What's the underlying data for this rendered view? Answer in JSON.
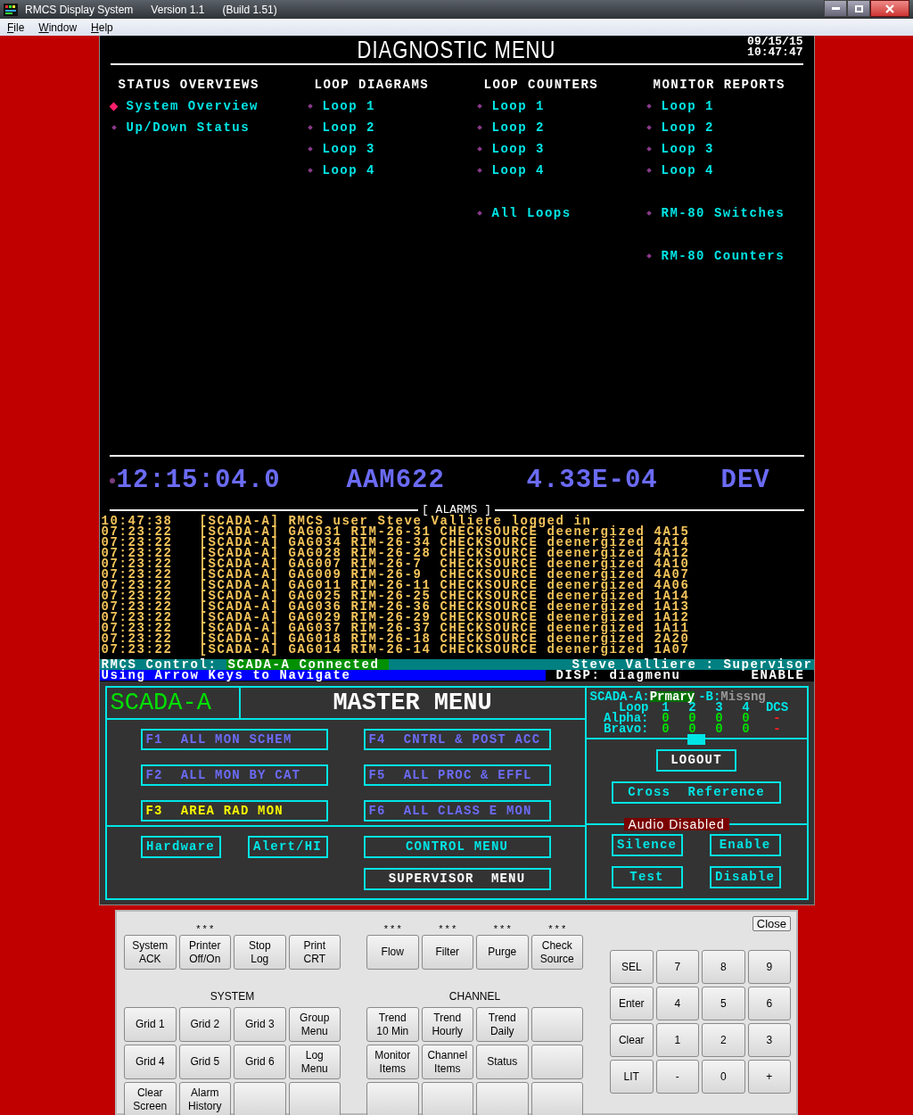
{
  "window": {
    "title": "RMCS Display System",
    "version": "Version 1.1",
    "build": "(Build 1.51)"
  },
  "menubar": [
    {
      "label": "File"
    },
    {
      "label": "Window"
    },
    {
      "label": "Help"
    }
  ],
  "screen": {
    "title": "DIAGNOSTIC MENU",
    "date": "09/15/15",
    "time": "10:47:47",
    "columns": [
      {
        "heading": "STATUS OVERVIEWS",
        "groups": [
          [
            {
              "label": "System Overview",
              "selected": true
            },
            {
              "label": "Up/Down Status",
              "selected": false
            }
          ]
        ]
      },
      {
        "heading": "LOOP DIAGRAMS",
        "groups": [
          [
            {
              "label": "Loop 1",
              "selected": false
            },
            {
              "label": "Loop 2",
              "selected": false
            },
            {
              "label": "Loop 3",
              "selected": false
            },
            {
              "label": "Loop 4",
              "selected": false
            }
          ]
        ]
      },
      {
        "heading": "LOOP COUNTERS",
        "groups": [
          [
            {
              "label": "Loop 1",
              "selected": false
            },
            {
              "label": "Loop 2",
              "selected": false
            },
            {
              "label": "Loop 3",
              "selected": false
            },
            {
              "label": "Loop 4",
              "selected": false
            }
          ],
          [
            {
              "label": "All Loops",
              "selected": false
            }
          ]
        ]
      },
      {
        "heading": "MONITOR REPORTS",
        "groups": [
          [
            {
              "label": "Loop 1",
              "selected": false
            },
            {
              "label": "Loop 2",
              "selected": false
            },
            {
              "label": "Loop 3",
              "selected": false
            },
            {
              "label": "Loop 4",
              "selected": false
            }
          ],
          [
            {
              "label": "RM-80 Switches",
              "selected": false
            }
          ],
          [
            {
              "label": "RM-80 Counters",
              "selected": false
            }
          ]
        ]
      }
    ],
    "readout": [
      "12:15:04.0",
      "AAM622",
      "4.33E-04",
      "DEV"
    ],
    "alarms_title": "[ ALARMS ]",
    "alarms": [
      {
        "time": "10:47:38",
        "source": "[SCADA-A]",
        "message": "RMCS user Steve Valliere logged in"
      },
      {
        "time": "07:23:22",
        "source": "[SCADA-A]",
        "message": "GAG031 RIM-26-31 CHECKSOURCE deenergized 4A15"
      },
      {
        "time": "07:23:22",
        "source": "[SCADA-A]",
        "message": "GAG034 RIM-26-34 CHECKSOURCE deenergized 4A14"
      },
      {
        "time": "07:23:22",
        "source": "[SCADA-A]",
        "message": "GAG028 RIM-26-28 CHECKSOURCE deenergized 4A12"
      },
      {
        "time": "07:23:22",
        "source": "[SCADA-A]",
        "message": "GAG007 RIM-26-7  CHECKSOURCE deenergized 4A10"
      },
      {
        "time": "07:23:22",
        "source": "[SCADA-A]",
        "message": "GAG009 RIM-26-9  CHECKSOURCE deenergized 4A07"
      },
      {
        "time": "07:23:22",
        "source": "[SCADA-A]",
        "message": "GAG011 RIM-26-11 CHECKSOURCE deenergized 4A06"
      },
      {
        "time": "07:23:22",
        "source": "[SCADA-A]",
        "message": "GAG025 RIM-26-25 CHECKSOURCE deenergized 1A14"
      },
      {
        "time": "07:23:22",
        "source": "[SCADA-A]",
        "message": "GAG036 RIM-26-36 CHECKSOURCE deenergized 1A13"
      },
      {
        "time": "07:23:22",
        "source": "[SCADA-A]",
        "message": "GAG029 RIM-26-29 CHECKSOURCE deenergized 1A12"
      },
      {
        "time": "07:23:22",
        "source": "[SCADA-A]",
        "message": "GAG037 RIM-26-37 CHECKSOURCE deenergized 1A11"
      },
      {
        "time": "07:23:22",
        "source": "[SCADA-A]",
        "message": "GAG018 RIM-26-18 CHECKSOURCE deenergized 2A20"
      },
      {
        "time": "07:23:22",
        "source": "[SCADA-A]",
        "message": "GAG014 RIM-26-14 CHECKSOURCE deenergized 1A07"
      }
    ],
    "status": {
      "control_label": "RMCS Control:",
      "control_value": "SCADA-A Connected",
      "user": "Steve Valliere : Supervisor",
      "hint": "Using Arrow Keys to Navigate",
      "display": "DISP: diagmenu",
      "mode": "ENABLE"
    }
  },
  "master": {
    "system": "SCADA-A",
    "title": "MASTER MENU",
    "functions": [
      {
        "key": "F1",
        "label": "ALL MON SCHEM",
        "color": "#6b6bf5"
      },
      {
        "key": "F4",
        "label": "CNTRL & POST ACC",
        "color": "#6b6bf5"
      },
      {
        "key": "F2",
        "label": "ALL MON BY CAT",
        "color": "#6b6bf5"
      },
      {
        "key": "F5",
        "label": "ALL PROC & EFFL",
        "color": "#6b6bf5"
      },
      {
        "key": "F3",
        "label": "AREA RAD MON",
        "color": "#f5f500"
      },
      {
        "key": "F6",
        "label": "ALL CLASS E MON",
        "color": "#6b6bf5"
      }
    ],
    "small_buttons": [
      {
        "label": "Hardware",
        "color": "#00e5e5"
      },
      {
        "label": "Alert/HI",
        "color": "#00e5e5"
      }
    ],
    "wide_buttons": [
      {
        "label": "CONTROL MENU",
        "color": "#00e5e5"
      },
      {
        "label": "SUPERVISOR  MENU",
        "color": "#ffffff"
      }
    ],
    "redundancy": {
      "a_label": "SCADA-A:",
      "a_value": "Prmary",
      "b_label": "-B:",
      "b_value": "Missng",
      "loop_label": "Loop",
      "loops": [
        "1",
        "2",
        "3",
        "4",
        "DCS"
      ],
      "rows": [
        {
          "label": "Alpha:",
          "cells": [
            {
              "text": "0",
              "color": "#00e000"
            },
            {
              "text": "0",
              "color": "#00e000"
            },
            {
              "text": "0",
              "color": "#00e000"
            },
            {
              "text": "0",
              "color": "#00e000"
            },
            {
              "text": "-",
              "color": "#ff2020"
            }
          ]
        },
        {
          "label": "Bravo:",
          "cells": [
            {
              "text": "0",
              "color": "#00e000"
            },
            {
              "text": "0",
              "color": "#00e000"
            },
            {
              "text": "0",
              "color": "#00e000"
            },
            {
              "text": "0",
              "color": "#00e000"
            },
            {
              "text": "-",
              "color": "#ff2020"
            }
          ]
        }
      ]
    },
    "side_buttons": [
      {
        "label": "LOGOUT",
        "color": "#ffffff"
      },
      {
        "label": "Cross  Reference",
        "color": "#00e5e5"
      }
    ],
    "audio": {
      "label": "Audio Disabled",
      "buttons": [
        {
          "label": "Silence"
        },
        {
          "label": "Enable"
        },
        {
          "label": "Test"
        },
        {
          "label": "Disable"
        }
      ]
    }
  },
  "keypad": {
    "close": "Close",
    "system_top": [
      {
        "kind": "key",
        "lines": [
          "System",
          "ACK"
        ]
      },
      {
        "kind": "key",
        "lines": [
          "Printer",
          "Off/On"
        ],
        "note": "* * *"
      },
      {
        "kind": "key",
        "lines": [
          "Stop",
          "Log"
        ]
      },
      {
        "kind": "key",
        "lines": [
          "Print",
          "CRT"
        ]
      }
    ],
    "channel_top": [
      {
        "kind": "key",
        "lines": [
          "Flow"
        ],
        "note": "* * *"
      },
      {
        "kind": "key",
        "lines": [
          "Filter"
        ],
        "note": "* * *"
      },
      {
        "kind": "key",
        "lines": [
          "Purge"
        ],
        "note": "* * *"
      },
      {
        "kind": "key",
        "lines": [
          "Check",
          "Source"
        ],
        "note": "* * *"
      }
    ],
    "system_title": "SYSTEM",
    "channel_title": "CHANNEL",
    "system_grid": [
      {
        "kind": "key",
        "lines": [
          "Grid 1"
        ]
      },
      {
        "kind": "key",
        "lines": [
          "Grid 2"
        ]
      },
      {
        "kind": "key",
        "lines": [
          "Grid 3"
        ]
      },
      {
        "kind": "key",
        "lines": [
          "Group",
          "Menu"
        ]
      },
      {
        "kind": "key",
        "lines": [
          "Grid 4"
        ]
      },
      {
        "kind": "key",
        "lines": [
          "Grid 5"
        ]
      },
      {
        "kind": "key",
        "lines": [
          "Grid 6"
        ]
      },
      {
        "kind": "key",
        "lines": [
          "Log",
          "Menu"
        ]
      },
      {
        "kind": "key",
        "lines": [
          "Clear",
          "Screen"
        ]
      },
      {
        "kind": "key",
        "lines": [
          "Alarm",
          "History"
        ]
      },
      {
        "kind": "blank"
      },
      {
        "kind": "blank"
      }
    ],
    "channel_grid": [
      {
        "kind": "key",
        "lines": [
          "Trend",
          "10 Min"
        ]
      },
      {
        "kind": "key",
        "lines": [
          "Trend",
          "Hourly"
        ]
      },
      {
        "kind": "key",
        "lines": [
          "Trend",
          "Daily"
        ]
      },
      {
        "kind": "blank"
      },
      {
        "kind": "key",
        "lines": [
          "Monitor",
          "Items"
        ]
      },
      {
        "kind": "key",
        "lines": [
          "Channel",
          "Items"
        ]
      },
      {
        "kind": "key",
        "lines": [
          "Status"
        ]
      },
      {
        "kind": "blank"
      },
      {
        "kind": "blank"
      },
      {
        "kind": "blank"
      },
      {
        "kind": "blank"
      },
      {
        "kind": "blank"
      }
    ],
    "numpad": [
      "SEL",
      "7",
      "8",
      "9",
      "Enter",
      "4",
      "5",
      "6",
      "Clear",
      "1",
      "2",
      "3",
      "LIT",
      "-",
      "0",
      "+"
    ]
  }
}
